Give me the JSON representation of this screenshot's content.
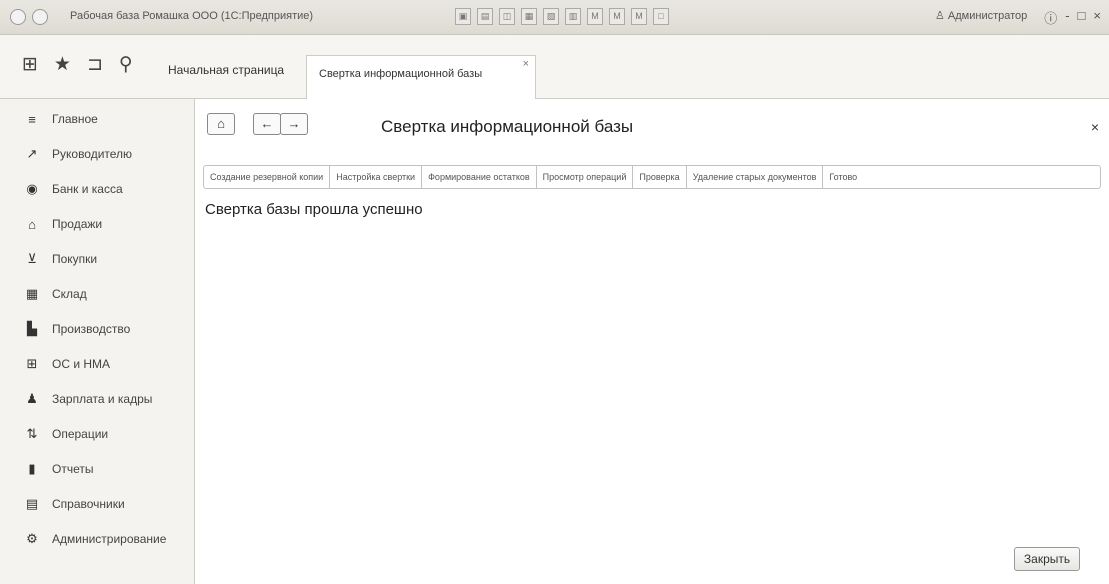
{
  "window": {
    "title": "Рабочая база Ромашка ООО (1С:Предприятие)",
    "user": "Администратор",
    "controls": [
      "ⓘ",
      "-",
      "□",
      "×"
    ]
  },
  "toolbar_icons": [
    "save-icon",
    "print-icon",
    "preview-icon",
    "calendar-icon",
    "calc-icon",
    "doc-icon",
    "mplus-icon",
    "mminus-icon",
    "mr-icon",
    "monitor-icon"
  ],
  "quick_panel": {
    "icons": [
      "apps-grid-icon",
      "star-icon",
      "history-icon",
      "search-icon"
    ],
    "home_tab": "Начальная страница",
    "active_tab": "Свертка информационной базы"
  },
  "sidebar": {
    "items": [
      {
        "icon": "menu-icon",
        "glyph": "≡",
        "label": "Главное"
      },
      {
        "icon": "chart-icon",
        "glyph": "↗",
        "label": "Руководителю"
      },
      {
        "icon": "bank-icon",
        "glyph": "◉",
        "label": "Банк и касса"
      },
      {
        "icon": "sales-icon",
        "glyph": "⌂",
        "label": "Продажи"
      },
      {
        "icon": "cart-icon",
        "glyph": "⊻",
        "label": "Покупки"
      },
      {
        "icon": "warehouse-icon",
        "glyph": "▦",
        "label": "Склад"
      },
      {
        "icon": "factory-icon",
        "glyph": "▙",
        "label": "Производство"
      },
      {
        "icon": "assets-icon",
        "glyph": "⊞",
        "label": "ОС и НМА"
      },
      {
        "icon": "people-icon",
        "glyph": "♟",
        "label": "Зарплата и кадры"
      },
      {
        "icon": "operations-icon",
        "glyph": "⇅",
        "label": "Операции"
      },
      {
        "icon": "reports-icon",
        "glyph": "▮",
        "label": "Отчеты"
      },
      {
        "icon": "catalog-icon",
        "glyph": "▤",
        "label": "Справочники"
      },
      {
        "icon": "gear-icon",
        "glyph": "⚙",
        "label": "Администрирование"
      }
    ]
  },
  "form": {
    "nav": {
      "home": "⌂",
      "back": "←",
      "forward": "→"
    },
    "title": "Свертка информационной базы",
    "close_glyph": "×",
    "steps": [
      "Создание резервной копии",
      "Настройка свертки",
      "Формирование остатков",
      "Просмотр операций",
      "Проверка",
      "Удаление старых документов",
      "Готово"
    ],
    "status": "Свертка базы прошла успешно",
    "close_button": "Закрыть"
  }
}
